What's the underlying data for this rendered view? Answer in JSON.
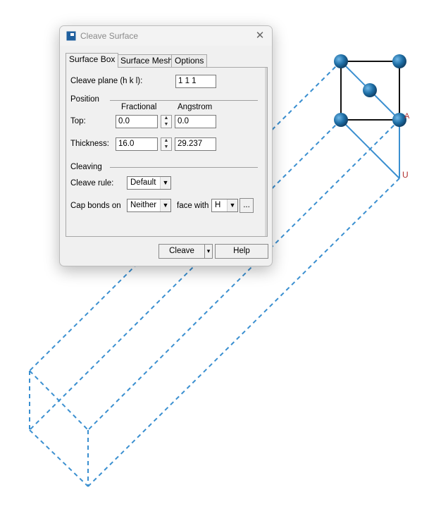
{
  "window": {
    "title": "Cleave Surface",
    "close_glyph": "✕"
  },
  "tabs": [
    {
      "label": "Surface Box",
      "active": true
    },
    {
      "label": "Surface Mesh",
      "active": false
    },
    {
      "label": "Options",
      "active": false
    }
  ],
  "cleave_plane": {
    "label": "Cleave plane (h k l):",
    "value": "1  1  1"
  },
  "position": {
    "section_label": "Position",
    "col_fractional": "Fractional",
    "col_angstrom": "Angstrom",
    "top": {
      "label": "Top:",
      "fractional": "0.0",
      "angstrom": "0.0"
    },
    "thickness": {
      "label": "Thickness:",
      "fractional": "16.0",
      "angstrom": "29.237"
    }
  },
  "cleaving": {
    "section_label": "Cleaving",
    "rule_label": "Cleave rule:",
    "rule_value": "Default",
    "cap_label": "Cap bonds on",
    "cap_value": "Neither",
    "face_label": "face with",
    "face_value": "H",
    "browse_label": "..."
  },
  "footer": {
    "cleave_label": "Cleave",
    "help_label": "Help",
    "split_glyph": "▾"
  },
  "viewport": {
    "crystal_labels": {
      "axis_a": "A",
      "axis_u": "U"
    },
    "colors": {
      "atom": "#1f6fa6",
      "cell_edge": "#111111",
      "slab": "#3a8fd0"
    }
  }
}
